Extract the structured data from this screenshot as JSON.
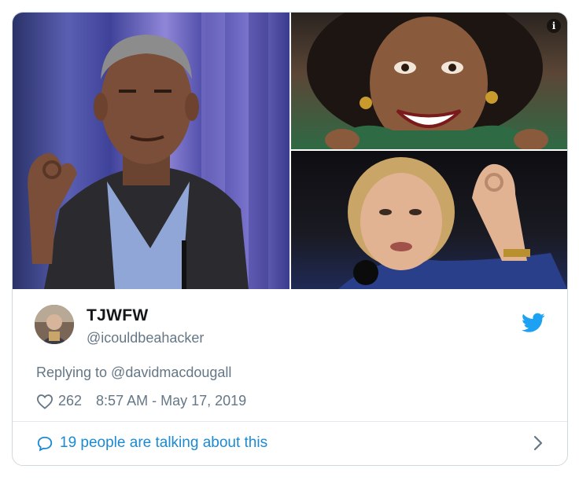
{
  "tweet": {
    "display_name": "TJWFW",
    "handle": "@icouldbeahacker",
    "replying_to": "Replying to @davidmacdougall",
    "likes": "262",
    "timestamp": "8:57 AM - May 17, 2019"
  },
  "footer": {
    "talking_label": "19 people are talking about this"
  },
  "icons": {
    "info": "i",
    "brand": "twitter-bird-icon",
    "like": "heart-icon",
    "comment": "speech-bubble-icon",
    "chevron": "chevron-right-icon"
  },
  "colors": {
    "accent": "#1da1f2",
    "link": "#1b8ad3",
    "secondary_text": "#657786",
    "primary_text": "#14171a",
    "border": "#cfd9de"
  }
}
